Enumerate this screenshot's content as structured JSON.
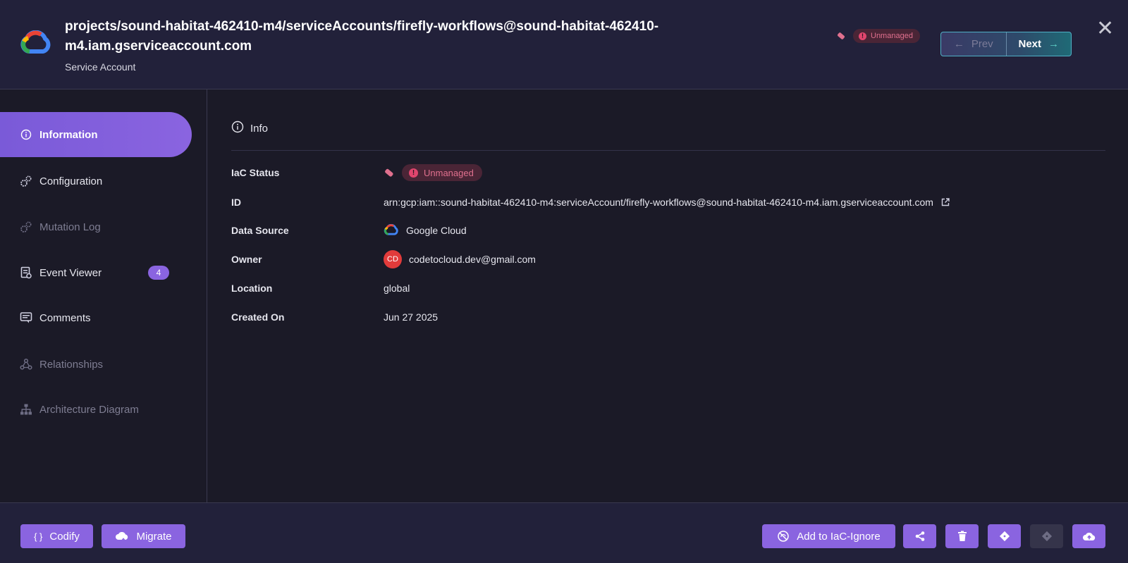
{
  "header": {
    "title": "projects/sound-habitat-462410-m4/serviceAccounts/firefly-workflows@sound-habitat-462410-m4.iam.gserviceaccount.com",
    "subtitle": "Service Account",
    "status_badge": "Unmanaged",
    "prev_label": "Prev",
    "next_label": "Next",
    "close_glyph": "✕",
    "prev_arrow": "←",
    "next_arrow": "→"
  },
  "sidebar": {
    "items": [
      {
        "label": "Information",
        "icon": "info-circle-icon",
        "active": true
      },
      {
        "label": "Configuration",
        "icon": "gears-icon"
      },
      {
        "label": "Mutation Log",
        "icon": "gears-icon",
        "muted": true
      },
      {
        "label": "Event Viewer",
        "icon": "event-viewer-icon",
        "count": "4"
      },
      {
        "label": "Comments",
        "icon": "comments-icon"
      },
      {
        "label": "Relationships",
        "icon": "relationships-icon",
        "muted": true
      },
      {
        "label": "Architecture Diagram",
        "icon": "sitemap-icon",
        "muted": true
      }
    ]
  },
  "main": {
    "section_title": "Info",
    "rows": {
      "iac_status": {
        "label": "IaC Status",
        "value": "Unmanaged"
      },
      "id": {
        "label": "ID",
        "value": "arn:gcp:iam::sound-habitat-462410-m4:serviceAccount/firefly-workflows@sound-habitat-462410-m4.iam.gserviceaccount.com"
      },
      "data_source": {
        "label": "Data Source",
        "value": "Google Cloud"
      },
      "owner": {
        "label": "Owner",
        "value": "codetocloud.dev@gmail.com",
        "initials": "CD"
      },
      "location": {
        "label": "Location",
        "value": "global"
      },
      "created_on": {
        "label": "Created On",
        "value": "Jun 27 2025"
      }
    }
  },
  "footer": {
    "codify_label": "Codify",
    "codify_glyph": "{ }",
    "migrate_label": "Migrate",
    "iac_ignore_label": "Add to IaC-Ignore"
  },
  "colors": {
    "accent": "#8a64e0",
    "background": "#1b1a27",
    "header_bg": "#22213a",
    "unmanaged_text": "#e0708e",
    "unmanaged_bg": "#4a2536",
    "owner_avatar": "#e23b3b"
  }
}
